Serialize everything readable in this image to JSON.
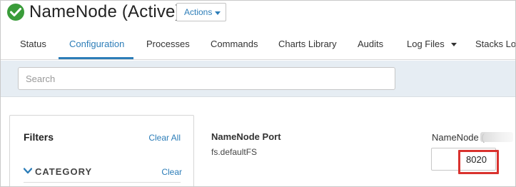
{
  "header": {
    "title": "NameNode (Active)",
    "status_icon": "check-circle-icon",
    "status_color": "#3a9c3a",
    "actions_label": "Actions"
  },
  "tabs": [
    {
      "label": "Status"
    },
    {
      "label": "Configuration",
      "active": true
    },
    {
      "label": "Processes"
    },
    {
      "label": "Commands"
    },
    {
      "label": "Charts Library"
    },
    {
      "label": "Audits"
    },
    {
      "label": "Log Files",
      "dropdown": true
    },
    {
      "label": "Stacks Log"
    }
  ],
  "search": {
    "placeholder": "Search",
    "value": ""
  },
  "filters": {
    "title": "Filters",
    "clear_all_label": "Clear All",
    "category_label": "CATEGORY",
    "category_clear_label": "Clear"
  },
  "property": {
    "display_name": "NameNode Port",
    "key": "fs.defaultFS",
    "instance_label": "NameNode (",
    "value": "8020"
  },
  "colors": {
    "accent": "#2c7db8",
    "highlight": "#d9322e",
    "search_strip": "#e6edf3"
  }
}
